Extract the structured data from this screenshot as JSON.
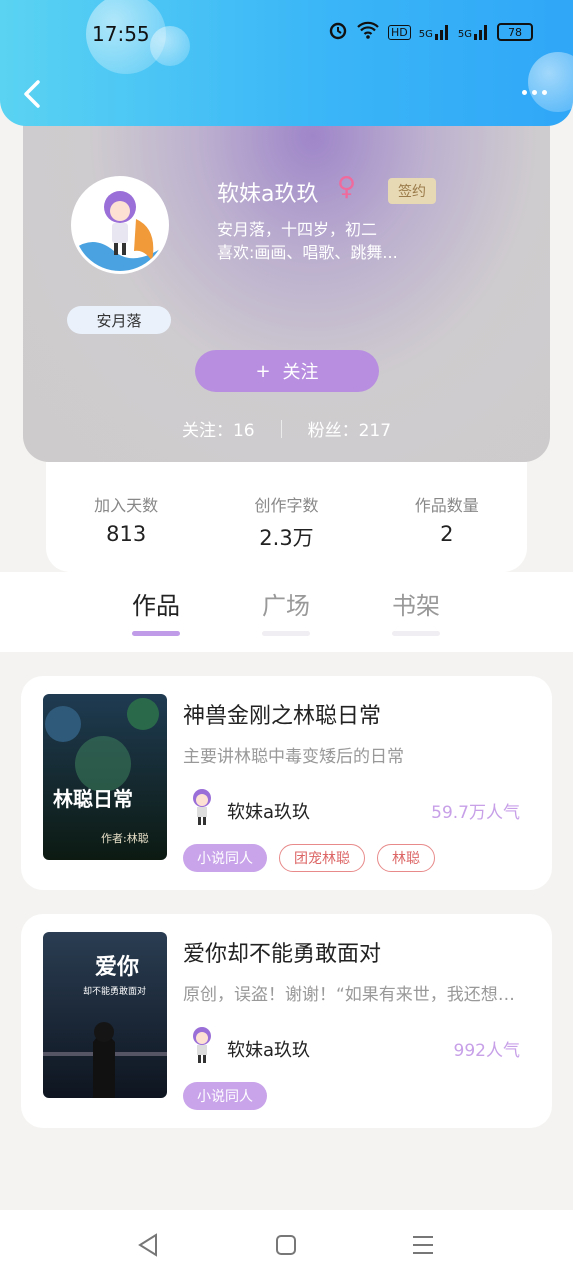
{
  "status_bar": {
    "time": "17:55",
    "battery": "78",
    "network_labels": [
      "HD",
      "5G",
      "5G"
    ]
  },
  "header": {
    "back_icon": "chevron-left-icon",
    "more_icon": "more-dots-icon"
  },
  "profile": {
    "username": "软妹a玖玖",
    "gender_symbol": "♀",
    "sign_badge": "签约",
    "bio_line1": "安月落，十四岁，初二",
    "bio_line2": "喜欢:画画、唱歌、跳舞...",
    "nickname_badge": "安月落",
    "follow_button": "关注",
    "follow_plus": "+",
    "following": "关注：16",
    "fans": "粉丝：217"
  },
  "stats": [
    {
      "label": "加入天数",
      "value": "813"
    },
    {
      "label": "创作字数",
      "value": "2.3万"
    },
    {
      "label": "作品数量",
      "value": "2"
    }
  ],
  "tabs": [
    {
      "label": "作品",
      "active": true
    },
    {
      "label": "广场",
      "active": false
    },
    {
      "label": "书架",
      "active": false
    }
  ],
  "works": [
    {
      "title": "神兽金刚之林聪日常",
      "description": "主要讲林聪中毒变矮后的日常",
      "author": "软妹a玖玖",
      "popularity": "59.7万人气",
      "tags": [
        {
          "label": "小说同人",
          "style": "fill"
        },
        {
          "label": "团宠林聪",
          "style": "outline"
        },
        {
          "label": "林聪",
          "style": "outline"
        }
      ],
      "cover_text": "林聪日常",
      "cover_author": "作者:林聪"
    },
    {
      "title": "爱你却不能勇敢面对",
      "description": "原创，误盗！谢谢！“如果有来世，我还想遇见你”",
      "author": "软妹a玖玖",
      "popularity": "992人气",
      "tags": [
        {
          "label": "小说同人",
          "style": "fill"
        }
      ],
      "cover_text": "爱你",
      "cover_subtext": "却不能勇敢面对"
    }
  ],
  "colors": {
    "header_blue": "#3bb6f7",
    "accent_purple": "#b88fe0",
    "tag_red": "#e88a8a",
    "sign_gold": "#e8d9b5"
  }
}
